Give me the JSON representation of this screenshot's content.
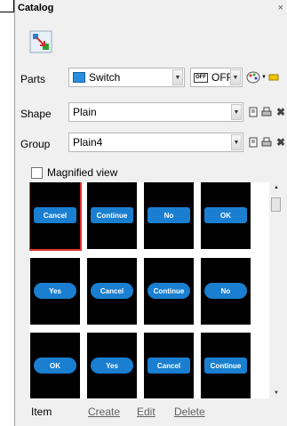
{
  "panel": {
    "title": "Catalog",
    "close_glyph": "×"
  },
  "rows": {
    "parts": {
      "label": "Parts",
      "value": "Switch",
      "state": "OFF",
      "state_badge": "OFF"
    },
    "shape": {
      "label": "Shape",
      "value": "Plain"
    },
    "group": {
      "label": "Group",
      "value": "Plain4"
    }
  },
  "magnified": {
    "label": "Magnified view",
    "checked": false
  },
  "tiles": [
    {
      "label": "Cancel",
      "style": "rect",
      "selected": true
    },
    {
      "label": "Continue",
      "style": "rect",
      "selected": false
    },
    {
      "label": "No",
      "style": "rect",
      "selected": false
    },
    {
      "label": "OK",
      "style": "rect",
      "selected": false
    },
    {
      "label": "Yes",
      "style": "round",
      "selected": false
    },
    {
      "label": "Cancel",
      "style": "round",
      "selected": false
    },
    {
      "label": "Continue",
      "style": "round",
      "selected": false
    },
    {
      "label": "No",
      "style": "round",
      "selected": false
    },
    {
      "label": "OK",
      "style": "round",
      "selected": false
    },
    {
      "label": "Yes",
      "style": "round",
      "selected": false
    },
    {
      "label": "Cancel",
      "style": "rect",
      "selected": false
    },
    {
      "label": "Continue",
      "style": "rect",
      "selected": false
    }
  ],
  "footer": {
    "item": "Item",
    "create": "Create",
    "edit": "Edit",
    "delete": "Delete"
  },
  "colors": {
    "accent": "#1a7fd0",
    "selected_border": "#e03030",
    "tile_bg": "#000000"
  }
}
